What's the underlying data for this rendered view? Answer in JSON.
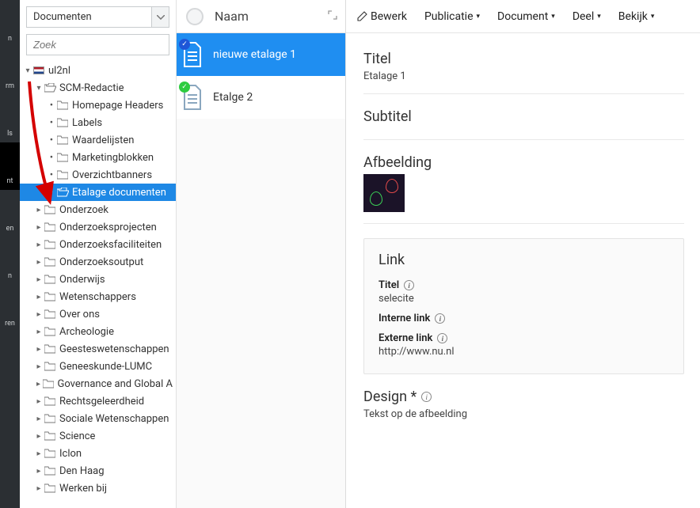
{
  "rail": {
    "items": [
      "n",
      "rm",
      "ls",
      "nt",
      "en",
      "n",
      "ren"
    ]
  },
  "tree_top": {
    "select_value": "Documenten",
    "search_placeholder": "Zoek"
  },
  "tree": [
    {
      "depth": 0,
      "arrow": "▾",
      "icon": "flag",
      "label": "ul2nl"
    },
    {
      "depth": 1,
      "arrow": "▾",
      "icon": "folder-open",
      "label": "SCM-Redactie"
    },
    {
      "depth": 2,
      "bullet": true,
      "icon": "folder",
      "label": "Homepage Headers"
    },
    {
      "depth": 2,
      "bullet": true,
      "icon": "folder",
      "label": "Labels"
    },
    {
      "depth": 2,
      "bullet": true,
      "icon": "folder",
      "label": "Waardelijsten"
    },
    {
      "depth": 2,
      "bullet": true,
      "icon": "folder",
      "label": "Marketingblokken"
    },
    {
      "depth": 2,
      "bullet": true,
      "icon": "folder",
      "label": "Overzichtbanners"
    },
    {
      "depth": 2,
      "bullet": true,
      "icon": "folder-open",
      "label": "Etalage documenten",
      "selected": true
    },
    {
      "depth": 1,
      "arrow": "▸",
      "icon": "folder",
      "label": "Onderzoek"
    },
    {
      "depth": 1,
      "arrow": "▸",
      "icon": "folder",
      "label": "Onderzoeksprojecten"
    },
    {
      "depth": 1,
      "arrow": "▸",
      "icon": "folder",
      "label": "Onderzoeksfaciliteiten"
    },
    {
      "depth": 1,
      "arrow": "▸",
      "icon": "folder",
      "label": "Onderzoeksoutput"
    },
    {
      "depth": 1,
      "arrow": "▸",
      "icon": "folder",
      "label": "Onderwijs"
    },
    {
      "depth": 1,
      "arrow": "▸",
      "icon": "folder",
      "label": "Wetenschappers"
    },
    {
      "depth": 1,
      "arrow": "▸",
      "icon": "folder",
      "label": "Over ons"
    },
    {
      "depth": 1,
      "arrow": "▸",
      "icon": "folder",
      "label": "Archeologie"
    },
    {
      "depth": 1,
      "arrow": "▸",
      "icon": "folder",
      "label": "Geesteswetenschappen"
    },
    {
      "depth": 1,
      "arrow": "▸",
      "icon": "folder",
      "label": "Geneeskunde-LUMC"
    },
    {
      "depth": 1,
      "arrow": "▸",
      "icon": "folder",
      "label": "Governance and Global A"
    },
    {
      "depth": 1,
      "arrow": "▸",
      "icon": "folder",
      "label": "Rechtsgeleerdheid"
    },
    {
      "depth": 1,
      "arrow": "▸",
      "icon": "folder",
      "label": "Sociale Wetenschappen"
    },
    {
      "depth": 1,
      "arrow": "▸",
      "icon": "folder",
      "label": "Science"
    },
    {
      "depth": 1,
      "arrow": "▸",
      "icon": "folder",
      "label": "Iclon"
    },
    {
      "depth": 1,
      "arrow": "▸",
      "icon": "folder",
      "label": "Den Haag"
    },
    {
      "depth": 1,
      "arrow": "▸",
      "icon": "folder",
      "label": "Werken bij"
    }
  ],
  "list": {
    "header": "Naam",
    "items": [
      {
        "name": "nieuwe etalage 1",
        "badge": "blue",
        "selected": true
      },
      {
        "name": "Etalge 2",
        "badge": "green",
        "selected": false
      }
    ]
  },
  "toolbar": {
    "edit": "Bewerk",
    "publish": "Publicatie",
    "document": "Document",
    "share": "Deel",
    "view": "Bekijk"
  },
  "detail": {
    "title_label": "Titel",
    "title_value": "Etalage 1",
    "subtitle_label": "Subtitel",
    "image_label": "Afbeelding",
    "link": {
      "heading": "Link",
      "title_label": "Titel",
      "title_value": "selecite",
      "internal_label": "Interne link",
      "external_label": "Externe link",
      "external_value": "http://www.nu.nl"
    },
    "design_label": "Design *",
    "design_value": "Tekst op de afbeelding"
  }
}
